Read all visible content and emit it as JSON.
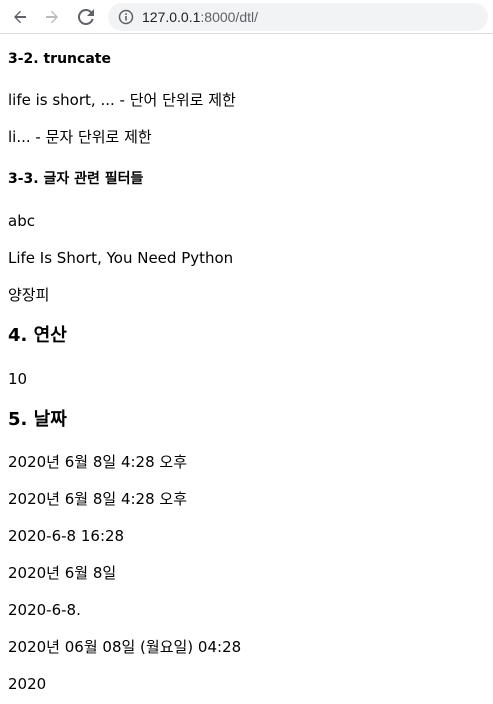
{
  "browser": {
    "url_host": "127.0.0.1",
    "url_path": ":8000/dtl/"
  },
  "page": {
    "truncate_heading": "3-2. truncate",
    "truncate_words": "life is short, ... - 단어 단위로 제한",
    "truncate_chars": "li... - 문자 단위로 제한",
    "filters_heading": "3-3. 글자 관련 필터들",
    "lower_text": "abc",
    "title_text": "Life Is Short, You Need Python",
    "length_text": "양장피",
    "calc_heading": "4. 연산",
    "calc_result": "10",
    "date_heading": "5. 날짜",
    "dates": [
      "2020년 6월 8일 4:28 오후",
      "2020년 6월 8일 4:28 오후",
      "2020-6-8 16:28",
      "2020년 6월 8일",
      "2020-6-8.",
      "2020년 06월 08일 (월요일) 04:28",
      "2020"
    ]
  }
}
